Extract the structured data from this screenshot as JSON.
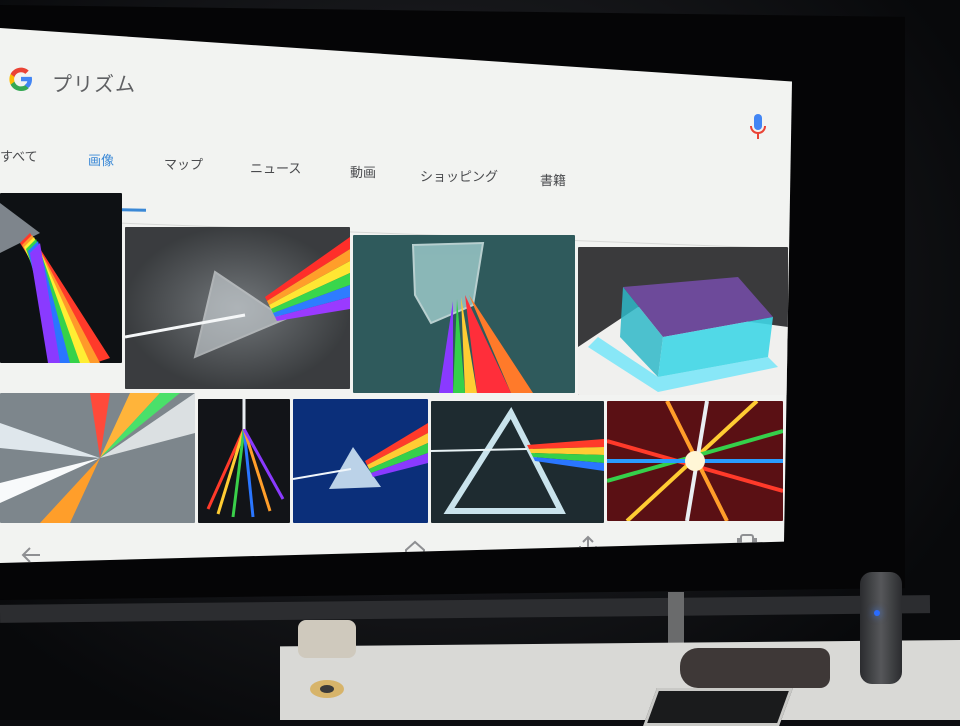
{
  "search": {
    "query": "プリズム"
  },
  "tabs": [
    {
      "label": "すべて",
      "active": false
    },
    {
      "label": "画像",
      "active": true
    },
    {
      "label": "マップ",
      "active": false
    },
    {
      "label": "ニュース",
      "active": false
    },
    {
      "label": "動画",
      "active": false
    },
    {
      "label": "ショッピング",
      "active": false
    },
    {
      "label": "書籍",
      "active": false
    }
  ],
  "colors": {
    "accent": "#3a88d6",
    "google_blue": "#4285F4",
    "google_red": "#EA4335",
    "google_yellow": "#FBBC05",
    "google_green": "#34A853",
    "led": "#2a6cff"
  },
  "images": {
    "row1": [
      "prism-rainbow-dark",
      "prism-triangle-rainbow",
      "prism-cube-teal",
      "glass-tank-water"
    ],
    "row2": [
      "light-burst-white",
      "light-streaks-dark",
      "prism-blue-rainbow",
      "prism-triangle-spectrum",
      "laser-starburst"
    ]
  },
  "navbar": {
    "icons": [
      "back-arrow-icon",
      "home-icon",
      "share-icon",
      "tabs-icon"
    ]
  }
}
